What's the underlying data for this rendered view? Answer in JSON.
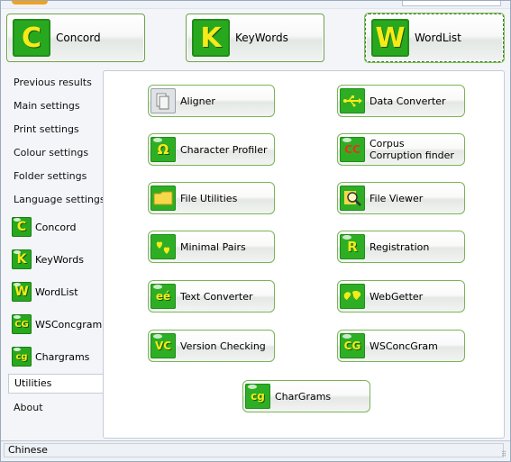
{
  "header": {
    "apps": [
      {
        "label": "Concord",
        "letter": "C",
        "icon": "concord-icon"
      },
      {
        "label": "KeyWords",
        "letter": "K",
        "icon": "keywords-icon"
      },
      {
        "label": "WordList",
        "letter": "W",
        "icon": "wordlist-icon"
      }
    ]
  },
  "sidebar": {
    "settings": [
      "Previous results",
      "Main settings",
      "Print settings",
      "Colour settings",
      "Folder settings",
      "Language settings"
    ],
    "apps": [
      {
        "label": "Concord",
        "letter": "C"
      },
      {
        "label": "KeyWords",
        "letter": "K"
      },
      {
        "label": "WordList",
        "letter": "W"
      },
      {
        "label": "WSConcgram",
        "letter": "CG"
      },
      {
        "label": "Chargrams",
        "letter": "cg"
      }
    ],
    "utilities": "Utilities",
    "about": "About"
  },
  "utilities": {
    "aligner": {
      "label": "Aligner",
      "icon": "aligner-icon"
    },
    "data_converter": {
      "label": "Data Converter",
      "icon": "usb-icon"
    },
    "character_profiler": {
      "label": "Character Profiler",
      "icon": "omega-icon",
      "glyph": "Ω"
    },
    "corpus_corruption": {
      "label": "Corpus Corruption finder",
      "icon": "cc-icon",
      "glyph": "CC"
    },
    "file_utilities": {
      "label": "File Utilities",
      "icon": "folder-icon"
    },
    "file_viewer": {
      "label": "File Viewer",
      "icon": "magnifier-icon"
    },
    "minimal_pairs": {
      "label": "Minimal Pairs",
      "icon": "hearts-icon"
    },
    "registration": {
      "label": "Registration",
      "icon": "r-icon",
      "glyph": "R"
    },
    "text_converter": {
      "label": "Text Converter",
      "icon": "ee-icon",
      "glyph": "eé"
    },
    "webgetter": {
      "label": "WebGetter",
      "icon": "globe-icon"
    },
    "version_checking": {
      "label": "Version Checking",
      "icon": "vc-icon",
      "glyph": "VC"
    },
    "wsconcgram": {
      "label": "WSConcGram",
      "icon": "wscg-icon",
      "glyph": "CG"
    },
    "chargrams": {
      "label": "CharGrams",
      "icon": "chargrams-icon",
      "glyph": "cg"
    }
  },
  "status": {
    "language": "Chinese"
  },
  "colors": {
    "icon_green": "#2eae24",
    "icon_letter": "#f6ea19",
    "button_border": "#7bb458"
  }
}
